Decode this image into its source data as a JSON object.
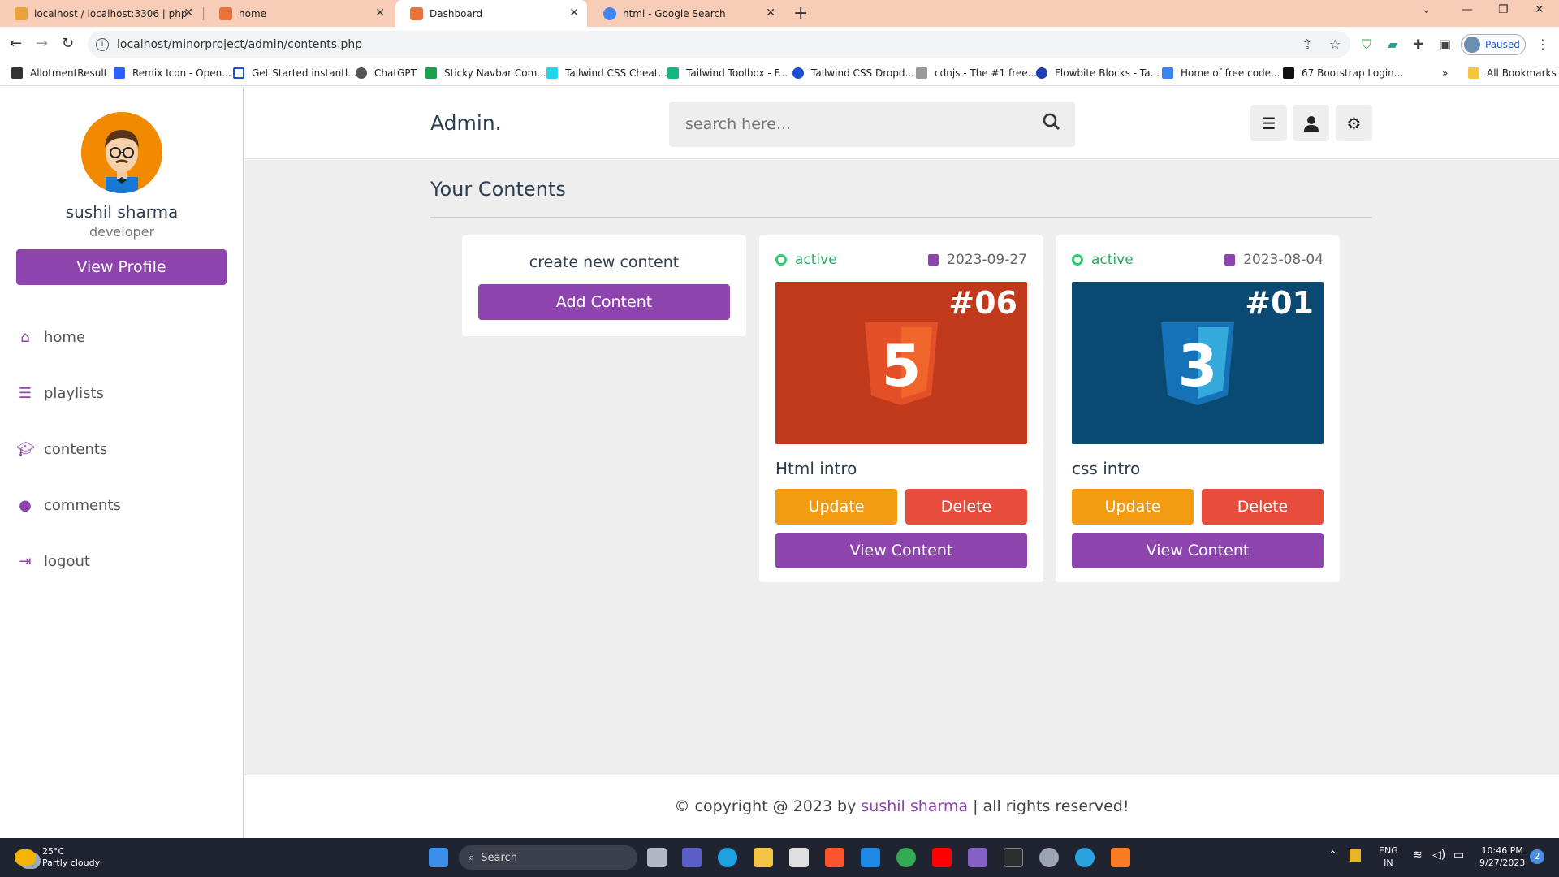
{
  "browser": {
    "tabs": [
      {
        "label": "localhost / localhost:3306 | php",
        "favicon_color": "#e8a33d"
      },
      {
        "label": "home",
        "favicon_color": "#e8743b"
      },
      {
        "label": "Dashboard",
        "favicon_color": "#e8743b"
      },
      {
        "label": "html - Google Search",
        "favicon_color": "#4285f4"
      }
    ],
    "url": "localhost/minorproject/admin/contents.php",
    "profile_status": "Paused",
    "bookmarks": [
      "AllotmentResult",
      "Remix Icon - Open...",
      "Get Started instantl...",
      "ChatGPT",
      "Sticky Navbar Com...",
      "Tailwind CSS Cheat...",
      "Tailwind Toolbox - F...",
      "Tailwind CSS Dropd...",
      "cdnjs - The #1 free...",
      "Flowbite Blocks - Ta...",
      "Home of free code...",
      "67 Bootstrap Login..."
    ],
    "bookmarks_more": "»",
    "all_bookmarks": "All Bookmarks"
  },
  "sidebar": {
    "user_name": "sushil sharma",
    "user_role": "developer",
    "view_profile_label": "View Profile",
    "nav": [
      {
        "label": "home",
        "icon": "home-icon"
      },
      {
        "label": "playlists",
        "icon": "list-icon"
      },
      {
        "label": "contents",
        "icon": "graduation-cap-icon"
      },
      {
        "label": "comments",
        "icon": "comment-icon"
      },
      {
        "label": "logout",
        "icon": "logout-icon"
      }
    ]
  },
  "header": {
    "logo": "Admin.",
    "search_placeholder": "search here..."
  },
  "main": {
    "heading": "Your Contents",
    "create_box": {
      "title": "create new content",
      "button_label": "Add Content"
    },
    "contents": [
      {
        "status": "active",
        "date": "2023-09-27",
        "thumb_number": "#06",
        "thumb_color": "#c0391b",
        "logo_number": "5",
        "logo_color": "#e34f26",
        "title": "Html intro",
        "update_label": "Update",
        "delete_label": "Delete",
        "view_label": "View Content"
      },
      {
        "status": "active",
        "date": "2023-08-04",
        "thumb_number": "#01",
        "thumb_color": "#0a4a72",
        "logo_number": "3",
        "logo_color": "#1572b6",
        "title": "css intro",
        "update_label": "Update",
        "delete_label": "Delete",
        "view_label": "View Content"
      }
    ]
  },
  "footer": {
    "prefix": "© copyright @ 2023 by ",
    "author": "sushil sharma",
    "suffix": " | all rights reserved!"
  },
  "taskbar": {
    "temperature": "25°C",
    "weather": "Partly cloudy",
    "search_label": "Search",
    "lang_1": "ENG",
    "lang_2": "IN",
    "time": "10:46 PM",
    "date": "9/27/2023",
    "notification_count": "2"
  },
  "colors": {
    "accent": "#8e44ad",
    "update": "#f39c12",
    "delete": "#e74c3c",
    "active": "#27ae60"
  }
}
